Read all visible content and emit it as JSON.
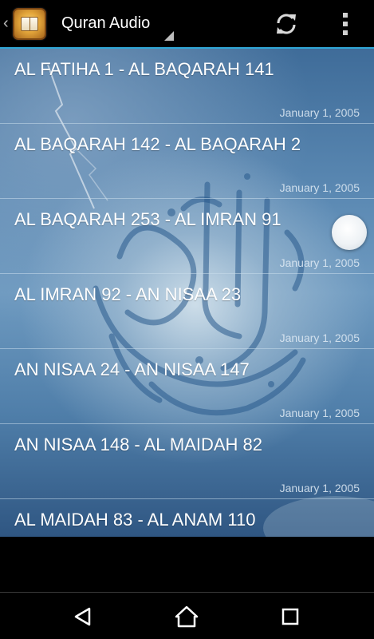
{
  "actionbar": {
    "title": "Quran Audio",
    "up_icon": "chevron-left-icon",
    "app_icon": "quran-book-icon",
    "refresh_icon": "refresh-icon",
    "overflow_icon": "more-vert-icon",
    "background": "#000000",
    "accent": "#2fa6d6"
  },
  "list": {
    "items": [
      {
        "title": "AL FATIHA 1 - AL BAQARAH 141",
        "date": "January 1, 2005"
      },
      {
        "title": "AL BAQARAH 142 - AL BAQARAH 2",
        "date": "January 1, 2005"
      },
      {
        "title": "AL BAQARAH 253 - AL IMRAN 91",
        "date": "January 1, 2005"
      },
      {
        "title": "AL IMRAN 92 - AN NISAA 23",
        "date": "January 1, 2005"
      },
      {
        "title": "AN NISAA 24 - AN NISAA 147",
        "date": "January 1, 2005"
      },
      {
        "title": "AN NISAA 148 - AL MAIDAH 82",
        "date": "January 1, 2005"
      },
      {
        "title": "AL MAIDAH 83 - AL ANAM 110",
        "date": ""
      }
    ]
  },
  "navbar": {
    "back_icon": "back-icon",
    "home_icon": "home-icon",
    "recents_icon": "recents-icon"
  }
}
